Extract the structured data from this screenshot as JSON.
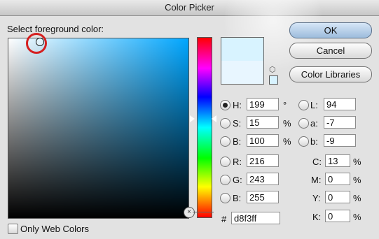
{
  "window": {
    "title": "Color Picker"
  },
  "prompt": "Select foreground color:",
  "colors": {
    "new": "#d8f3ff",
    "current": "#e8f6ff"
  },
  "buttons": {
    "ok": "OK",
    "cancel": "Cancel",
    "libraries": "Color Libraries"
  },
  "hsb": {
    "h": {
      "label": "H:",
      "value": "199",
      "unit": "°"
    },
    "s": {
      "label": "S:",
      "value": "15",
      "unit": "%"
    },
    "b": {
      "label": "B:",
      "value": "100",
      "unit": "%"
    }
  },
  "rgb": {
    "r": {
      "label": "R:",
      "value": "216"
    },
    "g": {
      "label": "G:",
      "value": "243"
    },
    "b": {
      "label": "B:",
      "value": "255"
    }
  },
  "lab": {
    "l": {
      "label": "L:",
      "value": "94"
    },
    "a": {
      "label": "a:",
      "value": "-7"
    },
    "b": {
      "label": "b:",
      "value": "-9"
    }
  },
  "cmyk": {
    "c": {
      "label": "C:",
      "value": "13",
      "unit": "%"
    },
    "m": {
      "label": "M:",
      "value": "0",
      "unit": "%"
    },
    "y": {
      "label": "Y:",
      "value": "0",
      "unit": "%"
    },
    "k": {
      "label": "K:",
      "value": "0",
      "unit": "%"
    }
  },
  "hex": {
    "label": "#",
    "value": "d8f3ff"
  },
  "web_only": {
    "label": "Only Web Colors",
    "checked": false
  },
  "icons": {
    "gamut": "cube-icon",
    "corner": "x-circle-icon"
  },
  "selected_mode": "H"
}
